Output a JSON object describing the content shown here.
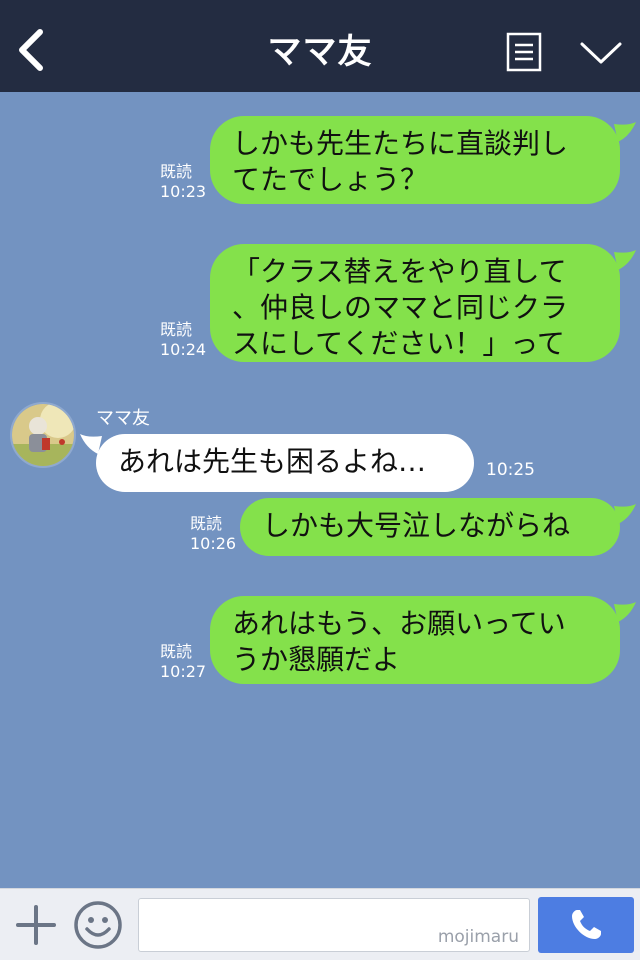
{
  "header": {
    "title": "ママ友",
    "back_icon": "chevron-left-icon",
    "menu_icon": "document-menu-icon",
    "collapse_icon": "chevron-down-icon"
  },
  "messages": [
    {
      "side": "mine",
      "lines": [
        "しかも先生たちに直談判し",
        "てたでしょう？"
      ],
      "read": "既読",
      "time": "10:23"
    },
    {
      "side": "mine",
      "lines": [
        "「クラス替えをやり直して",
        "、仲良しのママと同じクラ",
        "スにしてください！」って"
      ],
      "read": "既読",
      "time": "10:24"
    },
    {
      "side": "theirs",
      "sender": "ママ友",
      "lines": [
        "あれは先生も困るよね…"
      ],
      "time": "10:25"
    },
    {
      "side": "mine",
      "lines": [
        "しかも大号泣しながらね"
      ],
      "read": "既読",
      "time": "10:26"
    },
    {
      "side": "mine",
      "lines": [
        "あれはもう、お願いってい",
        "うか懇願だよ"
      ],
      "read": "既読",
      "time": "10:27"
    }
  ],
  "footer": {
    "plus_icon": "plus-icon",
    "emoji_icon": "smiley-icon",
    "input_value": "",
    "watermark": "mojimaru",
    "call_icon": "phone-icon"
  },
  "colors": {
    "header_bg": "#232c41",
    "chat_bg": "#7393c1",
    "my_bubble": "#84e14b",
    "their_bubble": "#ffffff",
    "call_button": "#4d7de2"
  }
}
